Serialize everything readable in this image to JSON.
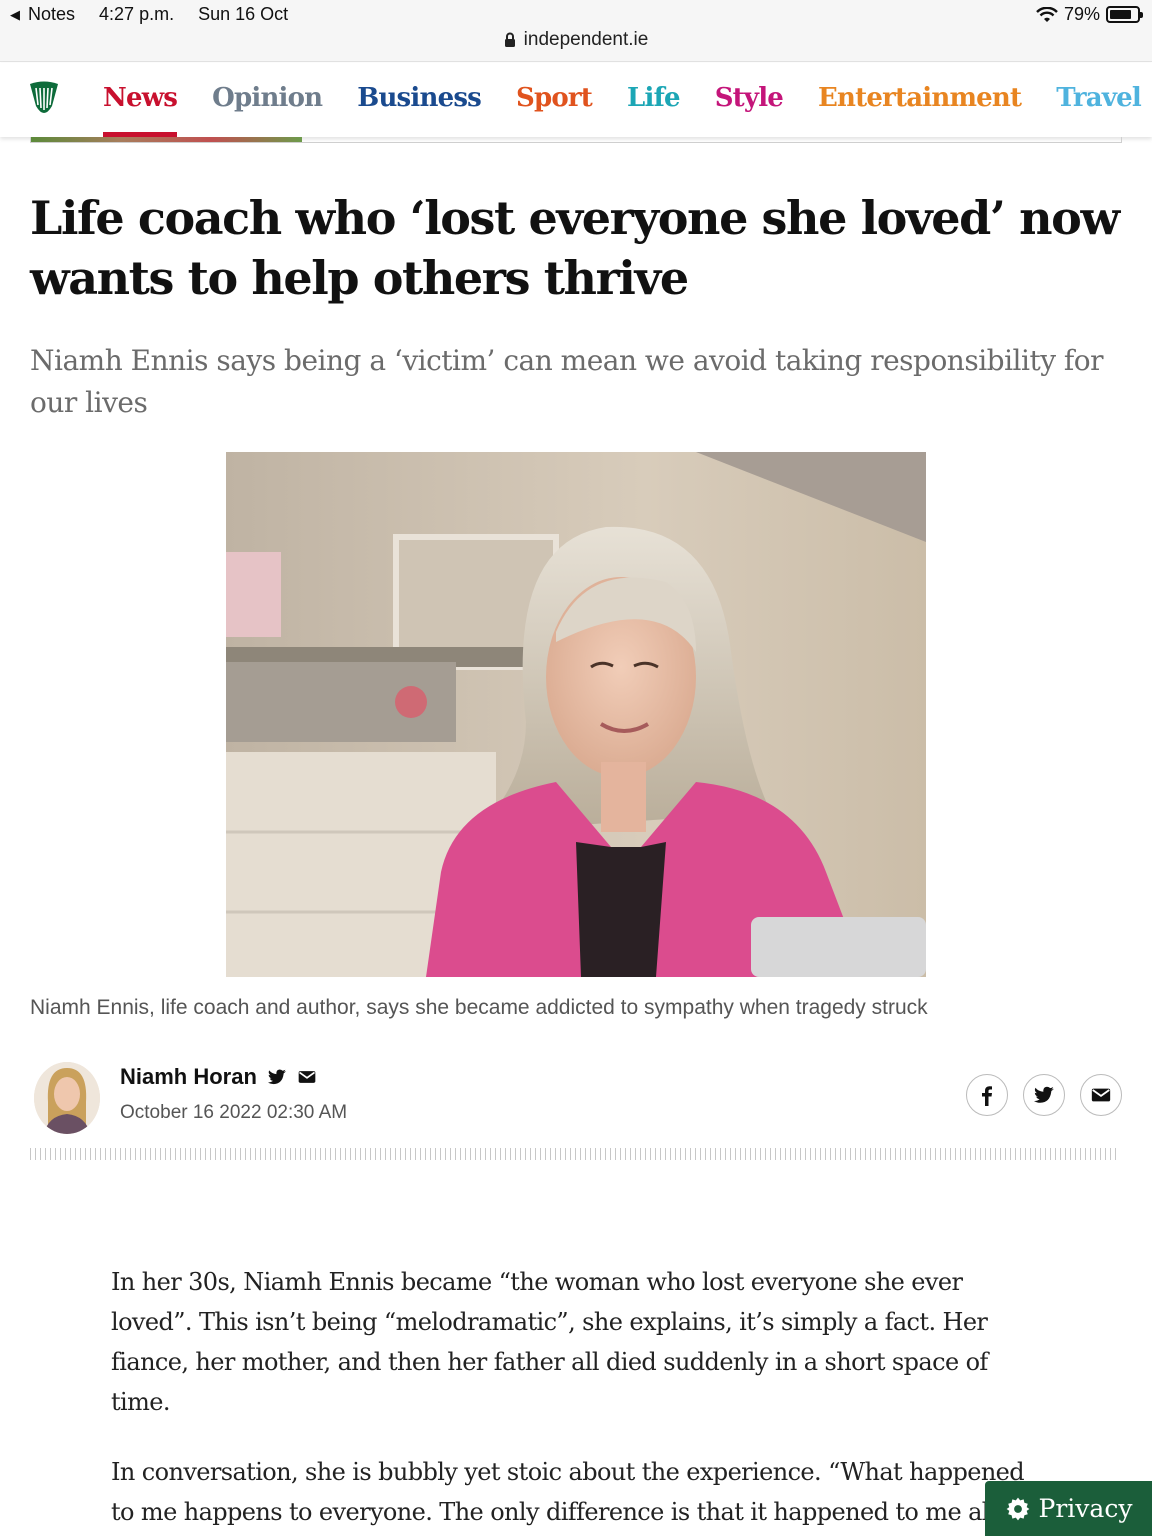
{
  "status_bar": {
    "back_app": "Notes",
    "time": "4:27 p.m.",
    "date": "Sun 16 Oct",
    "battery": "79%",
    "battery_level": 0.79
  },
  "url_bar": {
    "domain": "independent.ie"
  },
  "nav": {
    "logo": "harp-logo",
    "items": [
      {
        "label": "News",
        "color": "#c8102e",
        "active": true
      },
      {
        "label": "Opinion",
        "color": "#6f7d8c"
      },
      {
        "label": "Business",
        "color": "#1a4a8e"
      },
      {
        "label": "Sport",
        "color": "#e0531e"
      },
      {
        "label": "Life",
        "color": "#1ca6b5"
      },
      {
        "label": "Style",
        "color": "#c4157a"
      },
      {
        "label": "Entertainment",
        "color": "#e88521"
      },
      {
        "label": "Travel",
        "color": "#4fb3de"
      }
    ]
  },
  "article": {
    "headline": "Life coach who ‘lost everyone she loved’ now wants to help others thrive",
    "standfirst": "Niamh Ennis says being a ‘victim’ can mean we avoid taking responsibility for our lives",
    "caption": "Niamh Ennis, life coach and author, says she became addicted to sympathy when tragedy struck",
    "author": "Niamh Horan",
    "date": "October 16 2022 02:30 AM",
    "paragraphs": [
      "In her 30s, Niamh Ennis became “the woman who lost everyone she ever loved”. This isn’t being “melodramatic”, she explains, it’s simply a fact. Her fiance, her mother, and then her father all died suddenly in a short space of time.",
      "In conversation, she is bubbly yet stoic about the experience. “What happened to me happens to everyone. The only difference is that it happened to me al"
    ]
  },
  "share_icons": [
    "facebook-icon",
    "twitter-icon",
    "email-icon"
  ],
  "privacy": {
    "label": "Privacy",
    "color": "#1b5e3a"
  }
}
